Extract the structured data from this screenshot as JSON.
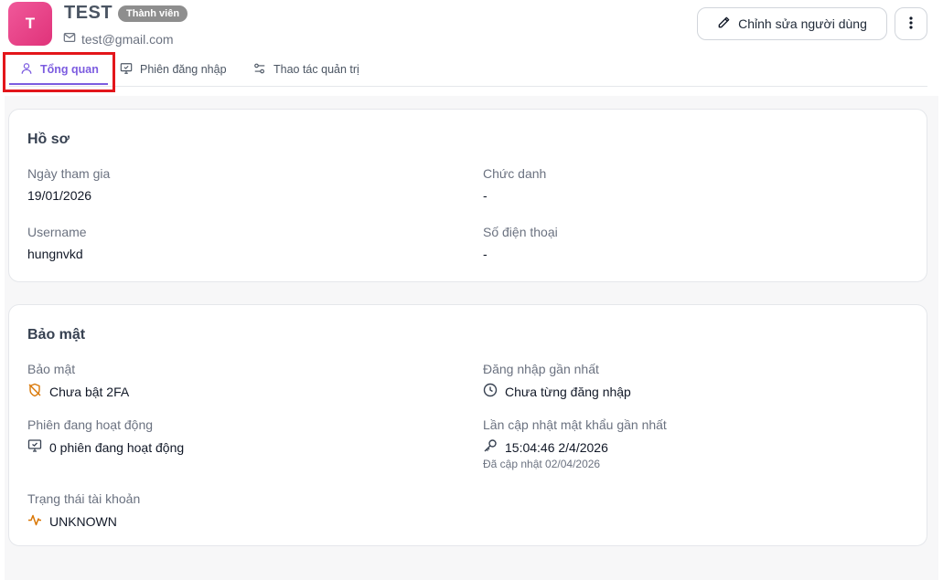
{
  "user": {
    "initial": "T",
    "name": "TEST",
    "role_badge": "Thành viên",
    "email": "test@gmail.com"
  },
  "header_actions": {
    "edit_label": "Chỉnh sửa người dùng"
  },
  "tabs": [
    {
      "label": "Tổng quan",
      "icon": "user-icon",
      "active": true
    },
    {
      "label": "Phiên đăng nhập",
      "icon": "monitor-icon",
      "active": false
    },
    {
      "label": "Thao tác quản trị",
      "icon": "settings-sliders-icon",
      "active": false
    }
  ],
  "profile": {
    "title": "Hồ sơ",
    "join_date_label": "Ngày tham gia",
    "join_date_value": "19/01/2026",
    "job_title_label": "Chức danh",
    "job_title_value": "-",
    "username_label": "Username",
    "username_value": "hungnvkd",
    "phone_label": "Số điện thoại",
    "phone_value": "-"
  },
  "security": {
    "title": "Bảo mật",
    "security_label": "Bảo mật",
    "security_value": "Chưa bật 2FA",
    "last_login_label": "Đăng nhập gần nhất",
    "last_login_value": "Chưa từng đăng nhập",
    "active_sessions_label": "Phiên đang hoạt động",
    "active_sessions_value": "0 phiên đang hoạt động",
    "password_update_label": "Lần cập nhật mật khẩu gần nhất",
    "password_update_value": "15:04:46 2/4/2026",
    "password_update_sub": "Đã cập nhật 02/04/2026",
    "account_status_label": "Trạng thái tài khoản",
    "account_status_value": "UNKNOWN"
  },
  "colors": {
    "accent": "#7c5ce0",
    "avatar": "#e83f86",
    "highlight": "#e3161b",
    "warning_icon": "#d97706"
  }
}
